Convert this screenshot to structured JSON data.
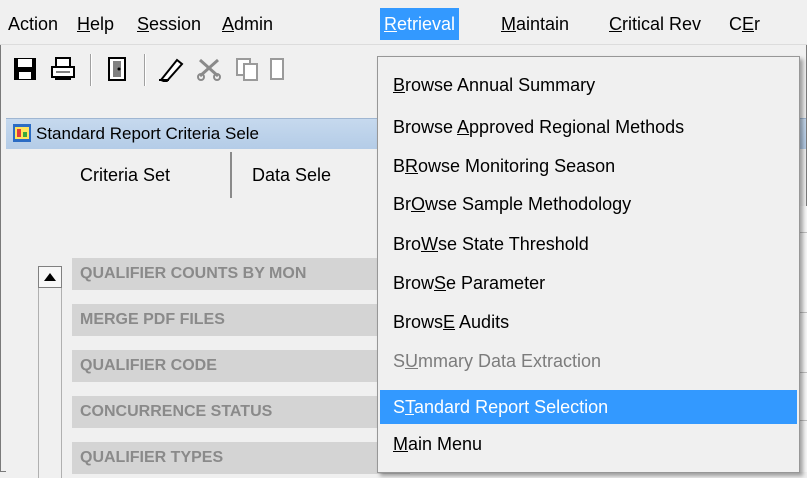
{
  "menubar": {
    "items": [
      {
        "label": "Action",
        "ul": ""
      },
      {
        "label": "Help",
        "ul": "H"
      },
      {
        "label": "Session",
        "ul": "S"
      },
      {
        "label": "Admin",
        "ul": "A"
      },
      {
        "label": "Retrieval",
        "ul": "R"
      },
      {
        "label": "Maintain",
        "ul": "M"
      },
      {
        "label": "Critical Rev",
        "ul": "C"
      },
      {
        "label": "CEr",
        "ul": "E"
      }
    ],
    "active": "Retrieval"
  },
  "toolbar": {
    "icons": [
      "save-icon",
      "print-icon",
      "exit-icon",
      "edit-icon",
      "cut-icon",
      "copy-icon",
      "paste-icon"
    ]
  },
  "window": {
    "title": "Standard Report Criteria Sele"
  },
  "tabs": [
    {
      "label": "Criteria Set"
    },
    {
      "label": "Data Sele"
    }
  ],
  "list": {
    "rows": [
      "QUALIFIER COUNTS BY MON",
      "MERGE PDF FILES",
      "QUALIFIER CODE",
      "CONCURRENCE STATUS",
      "QUALIFIER TYPES"
    ]
  },
  "retrieval_menu": {
    "items": [
      {
        "pre": "",
        "u": "B",
        "post": "rowse Annual Summary",
        "state": "normal"
      },
      {
        "pre": "Browse ",
        "u": "A",
        "post": "pproved Regional Methods",
        "state": "normal"
      },
      {
        "pre": "B",
        "u": "R",
        "post": "owse Monitoring Season",
        "state": "normal"
      },
      {
        "pre": "Br",
        "u": "O",
        "post": "wse Sample Methodology",
        "state": "normal"
      },
      {
        "pre": "Bro",
        "u": "W",
        "post": "se State Threshold",
        "state": "normal"
      },
      {
        "pre": "Brow",
        "u": "S",
        "post": "e Parameter",
        "state": "normal"
      },
      {
        "pre": "Brows",
        "u": "E",
        "post": " Audits",
        "state": "normal"
      },
      {
        "pre": "S",
        "u": "U",
        "post": "mmary Data Extraction",
        "state": "disabled"
      },
      {
        "pre": "S",
        "u": "T",
        "post": "andard Report Selection",
        "state": "selected"
      },
      {
        "pre": "",
        "u": "M",
        "post": "ain Menu",
        "state": "normal"
      }
    ]
  },
  "colors": {
    "highlight": "#3399ff",
    "menu_bg": "#f0f0f0",
    "disabled_text": "#7c7c7c",
    "list_row_bg": "#d4d4d4",
    "list_row_text": "#8a8a8a",
    "titlebar": "#b4cce7"
  }
}
